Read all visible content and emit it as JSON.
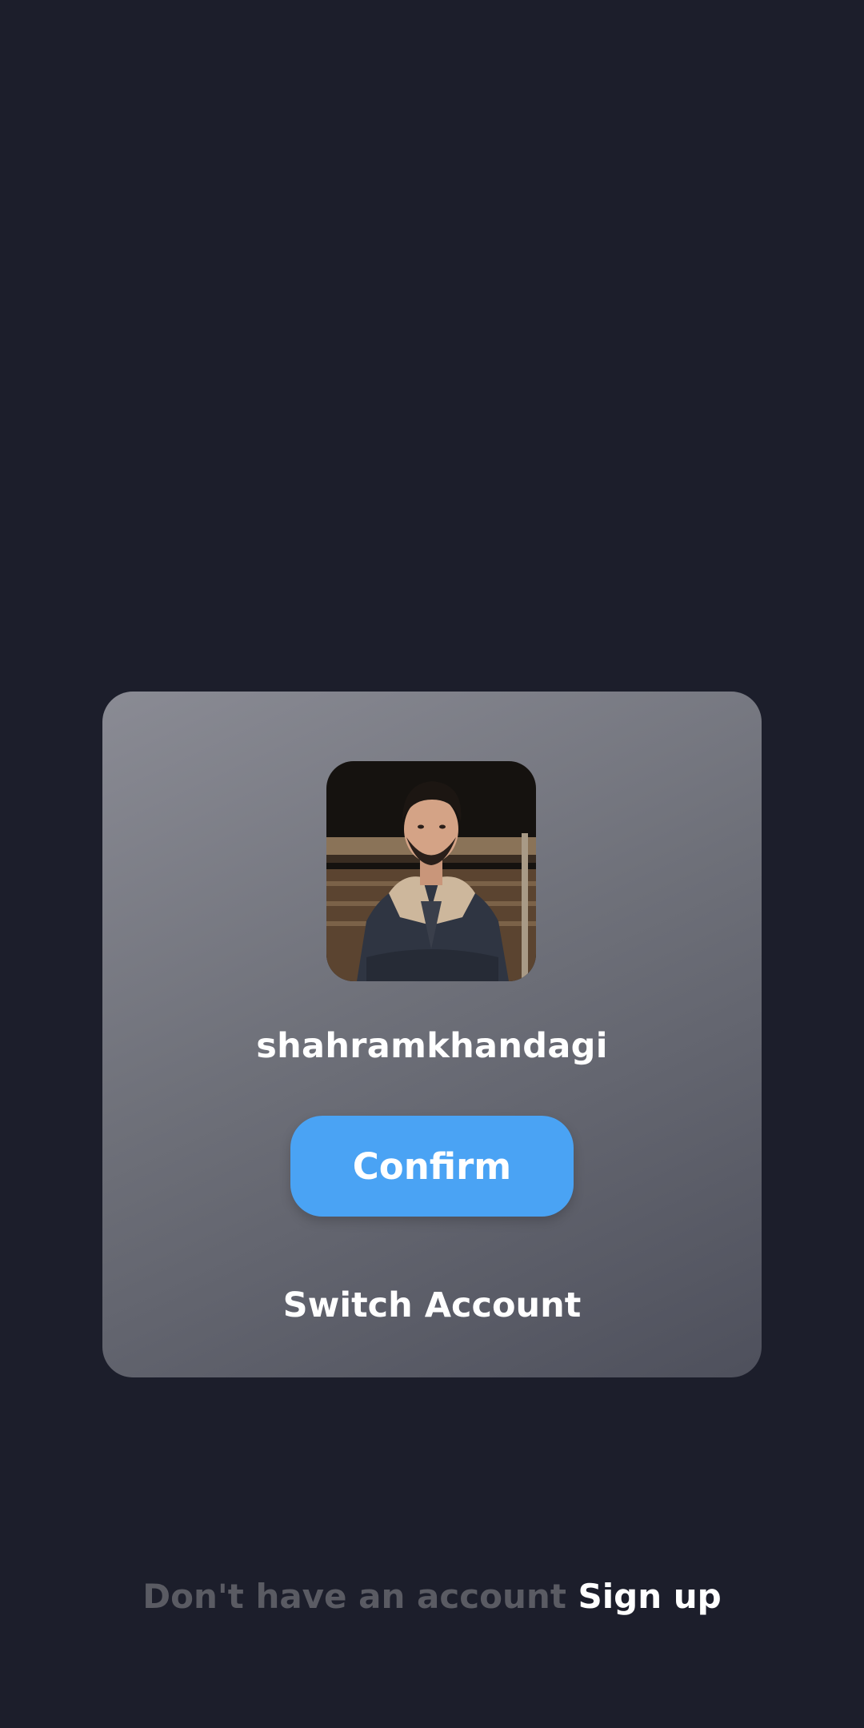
{
  "colors": {
    "background": "#1c1e2b",
    "card_gradient_start": "#8a8b94",
    "card_gradient_end": "#4e505c",
    "accent": "#4aa3f4",
    "muted_text": "#5a5b63",
    "text": "#ffffff"
  },
  "profile": {
    "username": "shahramkhandagi",
    "avatar_icon": "profile-photo"
  },
  "actions": {
    "confirm_label": "Confirm",
    "switch_account_label": "Switch Account"
  },
  "footer": {
    "prompt": "Don't have an account",
    "signup_label": "Sign up"
  }
}
